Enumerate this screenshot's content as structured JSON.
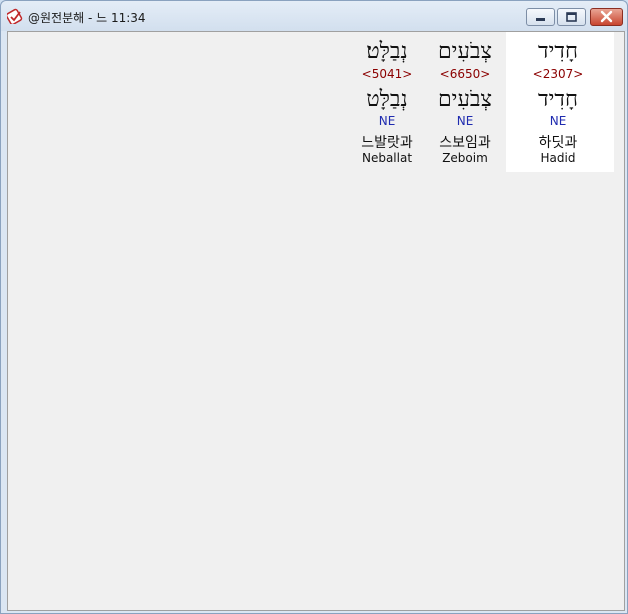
{
  "window": {
    "title": "@원전분해 - 느 11:34",
    "controls": [
      "minimize",
      "maximize",
      "close"
    ]
  },
  "words": [
    {
      "hebrew": "חָדִיד",
      "strongs": "<2307>",
      "hebrew_lex": "חָדִיד",
      "pos": "NE",
      "korean": "하딧과",
      "english": "Hadid"
    },
    {
      "hebrew": "צְבֹעִים",
      "strongs": "<6650>",
      "hebrew_lex": "צְבֹעִים",
      "pos": "NE",
      "korean": "스보임과",
      "english": "Zeboim"
    },
    {
      "hebrew": "נְבַלָּט׃",
      "strongs": "<5041>",
      "hebrew_lex": "נְבַלָּט",
      "pos": "NE",
      "korean": "느발랏과",
      "english": "Neballat"
    }
  ],
  "colors": {
    "strongs": "#8b0000",
    "pos": "#1f2bb0",
    "highlight": "#ffffff"
  }
}
